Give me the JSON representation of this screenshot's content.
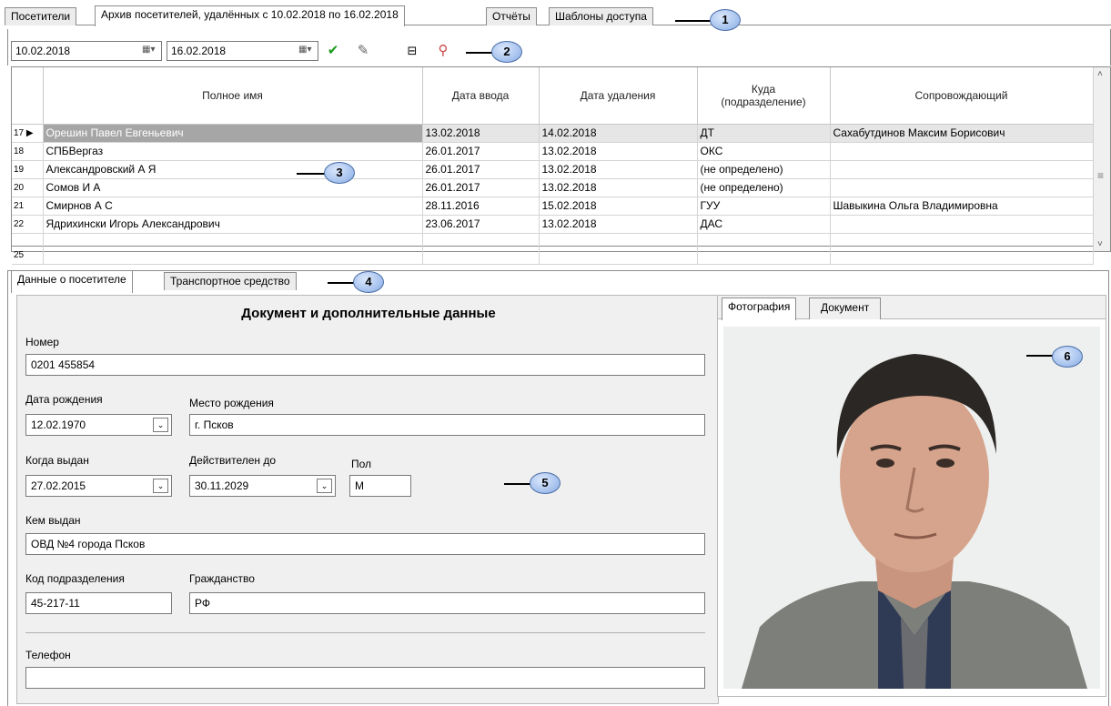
{
  "top_tabs": [
    {
      "label": "Посетители"
    },
    {
      "label": "Архив посетителей, удалённых с 10.02.2018 по 16.02.2018"
    },
    {
      "label": "Отчёты"
    },
    {
      "label": "Шаблоны доступа"
    }
  ],
  "callouts": [
    "1",
    "2",
    "3",
    "4",
    "5",
    "6"
  ],
  "toolbar": {
    "date_from": "10.02.2018",
    "date_to": "16.02.2018"
  },
  "grid": {
    "columns": [
      "Полное имя",
      "Дата ввода",
      "Дата удаления",
      "Куда (подразделение)",
      "Сопровождающий"
    ],
    "rows": [
      {
        "n": "17",
        "name": "Орешин Павел Евгеньевич",
        "date_in": "13.02.2018",
        "date_del": "14.02.2018",
        "dept": "ДТ",
        "escort": "Сахабутдинов Максим Борисович"
      },
      {
        "n": "18",
        "name": "СПБВергаз",
        "date_in": "26.01.2017",
        "date_del": "13.02.2018",
        "dept": "ОКС",
        "escort": ""
      },
      {
        "n": "19",
        "name": "Александровский А Я",
        "date_in": "26.01.2017",
        "date_del": "13.02.2018",
        "dept": "(не определено)",
        "escort": ""
      },
      {
        "n": "20",
        "name": "Сомов И А",
        "date_in": "26.01.2017",
        "date_del": "13.02.2018",
        "dept": "(не определено)",
        "escort": ""
      },
      {
        "n": "21",
        "name": "Смирнов А С",
        "date_in": "28.11.2016",
        "date_del": "15.02.2018",
        "dept": "ГУУ",
        "escort": "Шавыкина Ольга Владимировна"
      },
      {
        "n": "22",
        "name": "Ядрихински Игорь Александрович",
        "date_in": "23.06.2017",
        "date_del": "13.02.2018",
        "dept": "ДАС",
        "escort": ""
      },
      {
        "n": "25",
        "name": "",
        "date_in": "",
        "date_del": "",
        "dept": "",
        "escort": ""
      }
    ]
  },
  "lower_tabs": [
    {
      "label": "Данные о посетителе"
    },
    {
      "label": "Транспортное средство"
    }
  ],
  "form": {
    "title": "Документ и дополнительные данные",
    "number_label": "Номер",
    "number_value": "0201 455854",
    "birth_date_label": "Дата рождения",
    "birth_date_value": "12.02.1970",
    "birth_place_label": "Место рождения",
    "birth_place_value": "г. Псков",
    "issued_label": "Когда выдан",
    "issued_value": "27.02.2015",
    "valid_label": "Действителен до",
    "valid_value": "30.11.2029",
    "sex_label": "Пол",
    "sex_value": "М",
    "issued_by_label": "Кем выдан",
    "issued_by_value": "ОВД №4 города Псков",
    "code_label": "Код подразделения",
    "code_value": "45-217-11",
    "citizenship_label": "Гражданство",
    "citizenship_value": "РФ",
    "phone_label": "Телефон",
    "phone_value": ""
  },
  "photo_tabs": [
    {
      "label": "Фотография"
    },
    {
      "label": "Документ"
    }
  ]
}
